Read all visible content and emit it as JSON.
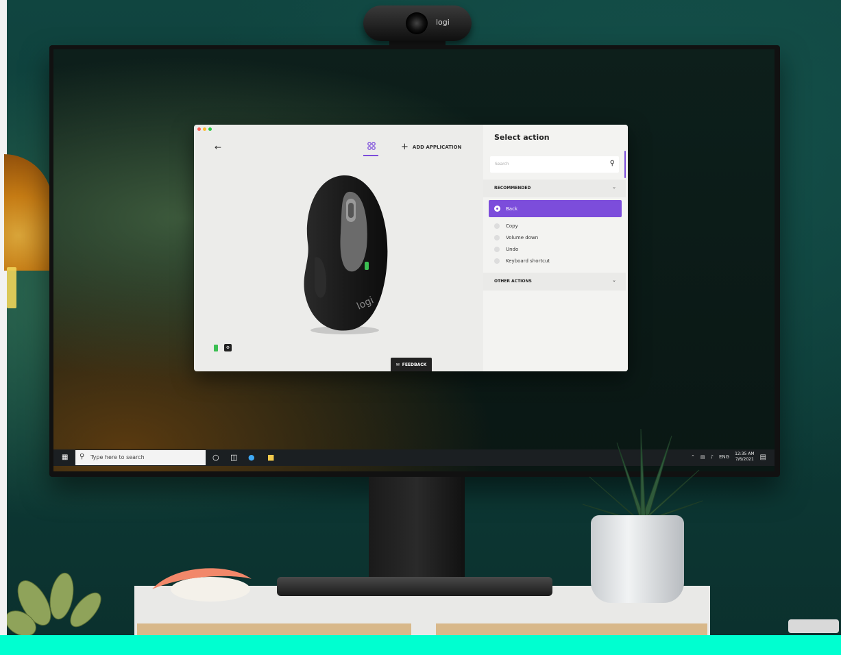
{
  "webcam": {
    "brand": "logi"
  },
  "app": {
    "back_icon": "arrow-left-icon",
    "add_application_label": "ADD APPLICATION",
    "mouse_brand": "logi",
    "feedback_label": "FEEDBACK",
    "panel": {
      "title": "Select action",
      "search_placeholder": "Search",
      "recommended_label": "RECOMMENDED",
      "selected_action": "Back",
      "options": [
        "Copy",
        "Volume down",
        "Undo",
        "Keyboard shortcut"
      ],
      "other_actions_label": "OTHER ACTIONS"
    },
    "accent_color": "#7c4ddb"
  },
  "taskbar": {
    "search_placeholder": "Type here to search",
    "language": "ENG",
    "time": "12:35 AM",
    "date": "7/6/2021"
  }
}
